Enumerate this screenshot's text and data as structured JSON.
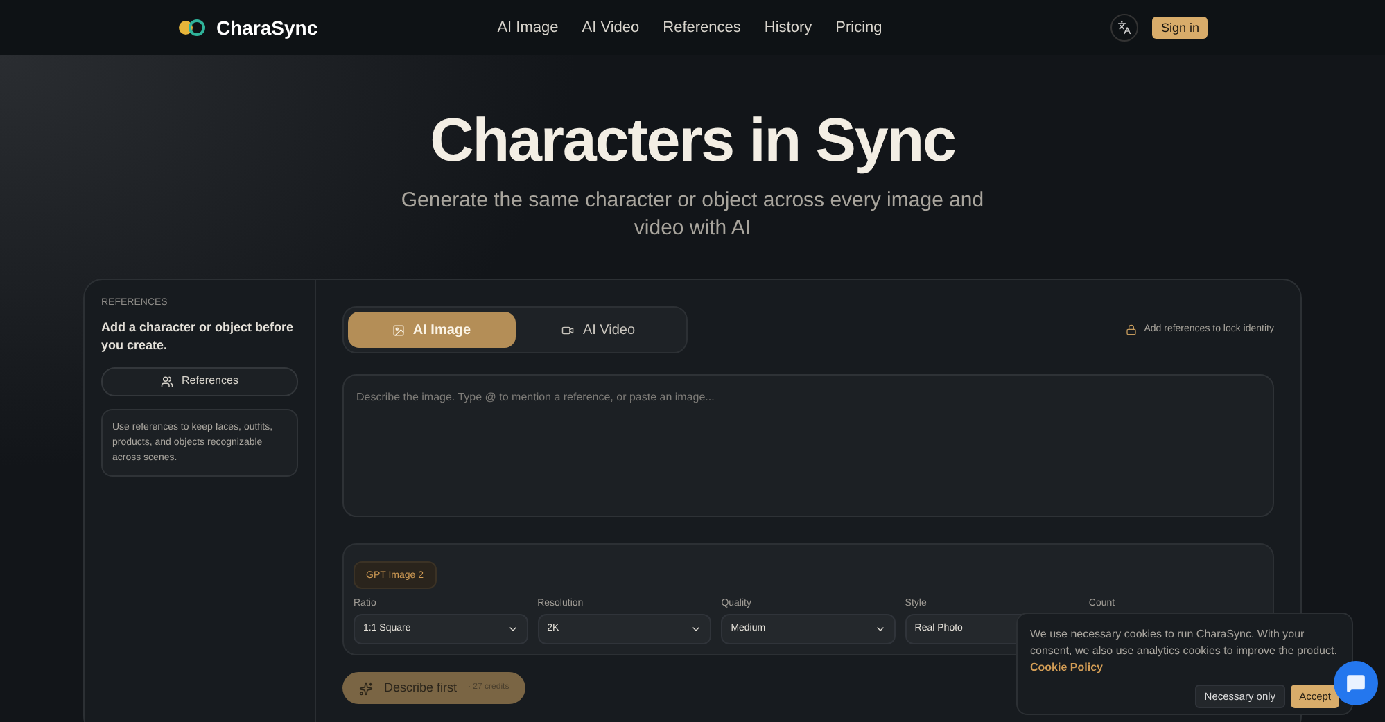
{
  "header": {
    "brand": "CharaSync",
    "nav": [
      {
        "label": "AI Image"
      },
      {
        "label": "AI Video"
      },
      {
        "label": "References"
      },
      {
        "label": "History"
      },
      {
        "label": "Pricing"
      }
    ],
    "sign_in": "Sign in"
  },
  "hero": {
    "title": "Characters in Sync",
    "subtitle": "Generate the same character or object across every image and video with AI"
  },
  "sidebar": {
    "eyebrow": "REFERENCES",
    "heading": "Add a character or object before you create.",
    "button": "References",
    "note": "Use references to keep faces, outfits, products, and objects recognizable across scenes."
  },
  "mode_tabs": [
    {
      "label": "AI Image",
      "kind": "image",
      "selected": true
    },
    {
      "label": "AI Video",
      "kind": "video",
      "selected": false
    }
  ],
  "lock_hint": "Add references to lock identity",
  "prompt": {
    "placeholder": "Describe the image. Type @ to mention a reference, or paste an image..."
  },
  "model_chip": "GPT Image 2",
  "settings": [
    {
      "label": "Ratio",
      "value": "1:1 Square"
    },
    {
      "label": "Resolution",
      "value": "2K"
    },
    {
      "label": "Quality",
      "value": "Medium"
    },
    {
      "label": "Style",
      "value": "Real Photo"
    },
    {
      "label": "Count"
    }
  ],
  "generate": {
    "label": "Describe first",
    "credits": "· 27 credits"
  },
  "cookie": {
    "text": "We use necessary cookies to run CharaSync. With your consent, we also use analytics cookies to improve the product.",
    "link": "Cookie Policy",
    "buttons": [
      {
        "label": "Necessary only",
        "kind": "secondary"
      },
      {
        "label": "Accept",
        "kind": "primary"
      }
    ]
  }
}
